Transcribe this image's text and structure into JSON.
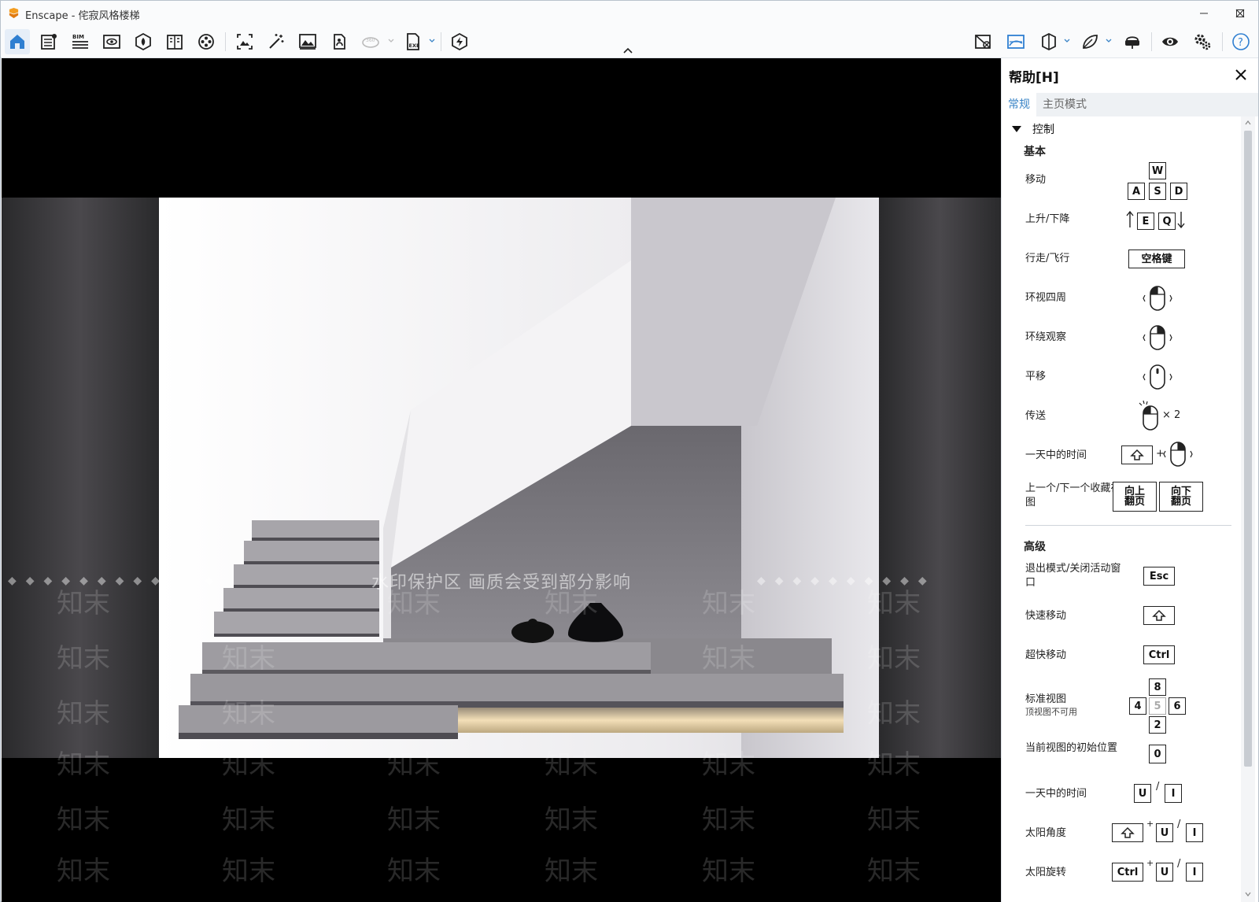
{
  "window": {
    "title": "Enscape - 侘寂风格楼梯",
    "controls": [
      "minimize-icon",
      "maximize-icon",
      "close-icon"
    ]
  },
  "toolbar": {
    "bim_label": "BIM",
    "left_icons": [
      "home-icon",
      "material-editor-icon",
      "bim-icon",
      "view-icon",
      "asset-library-icon",
      "book-icon",
      "video-editor-icon",
      "screenshot-icon",
      "batch-render-icon",
      "image-icon",
      "panorama-icon",
      "360-icon",
      "exe-export-icon",
      "live-update-icon"
    ],
    "right_icons": [
      "no-visual-icon",
      "visual-settings-icon",
      "cube-icon",
      "leaf-icon",
      "vr-headset-icon",
      "eye-icon",
      "settings-icon",
      "help-icon"
    ]
  },
  "viewport": {
    "watermark_banner": "水印保护区   画质会受到部分影响",
    "watermark_tile": "知末"
  },
  "help": {
    "title": "帮助[H]",
    "tabs": [
      "常规",
      "主页模式"
    ],
    "section": "控制",
    "basic": {
      "title": "基本",
      "rows": [
        {
          "label": "移动",
          "keys": [
            "W",
            "A",
            "S",
            "D"
          ]
        },
        {
          "label": "上升/下降",
          "keys": [
            "E",
            "Q"
          ]
        },
        {
          "label": "行走/飞行",
          "keys": [
            "空格键"
          ]
        },
        {
          "label": "环视四周"
        },
        {
          "label": "环绕观察"
        },
        {
          "label": "平移"
        },
        {
          "label": "传送",
          "suffix": "× 2"
        },
        {
          "label": "一天中的时间",
          "plus": "+"
        },
        {
          "label": "上一个/下一个收藏视图",
          "keys": [
            "向上翻页",
            "向下翻页"
          ]
        }
      ]
    },
    "advanced": {
      "title": "高级",
      "rows": [
        {
          "label": "退出模式/关闭活动窗口",
          "keys": [
            "Esc"
          ]
        },
        {
          "label": "快速移动"
        },
        {
          "label": "超快移动",
          "keys": [
            "Ctrl"
          ]
        },
        {
          "label": "标准视图",
          "sublabel": "顶视图不可用",
          "keys": [
            "8",
            "4",
            "5",
            "6",
            "2"
          ]
        },
        {
          "label": "当前视图的初始位置",
          "keys": [
            "0"
          ]
        },
        {
          "label": "一天中的时间",
          "keys": [
            "U",
            "I"
          ],
          "sep": "/"
        },
        {
          "label": "太阳角度",
          "keys": [
            "U",
            "I"
          ],
          "plus": "+",
          "sep": "/"
        },
        {
          "label": "太阳旋转",
          "keys": [
            "Ctrl",
            "U",
            "I"
          ],
          "plus": "+",
          "sep": "/"
        }
      ]
    }
  },
  "colors": {
    "accent": "#3a84c6",
    "logo": "#f39c1f"
  }
}
